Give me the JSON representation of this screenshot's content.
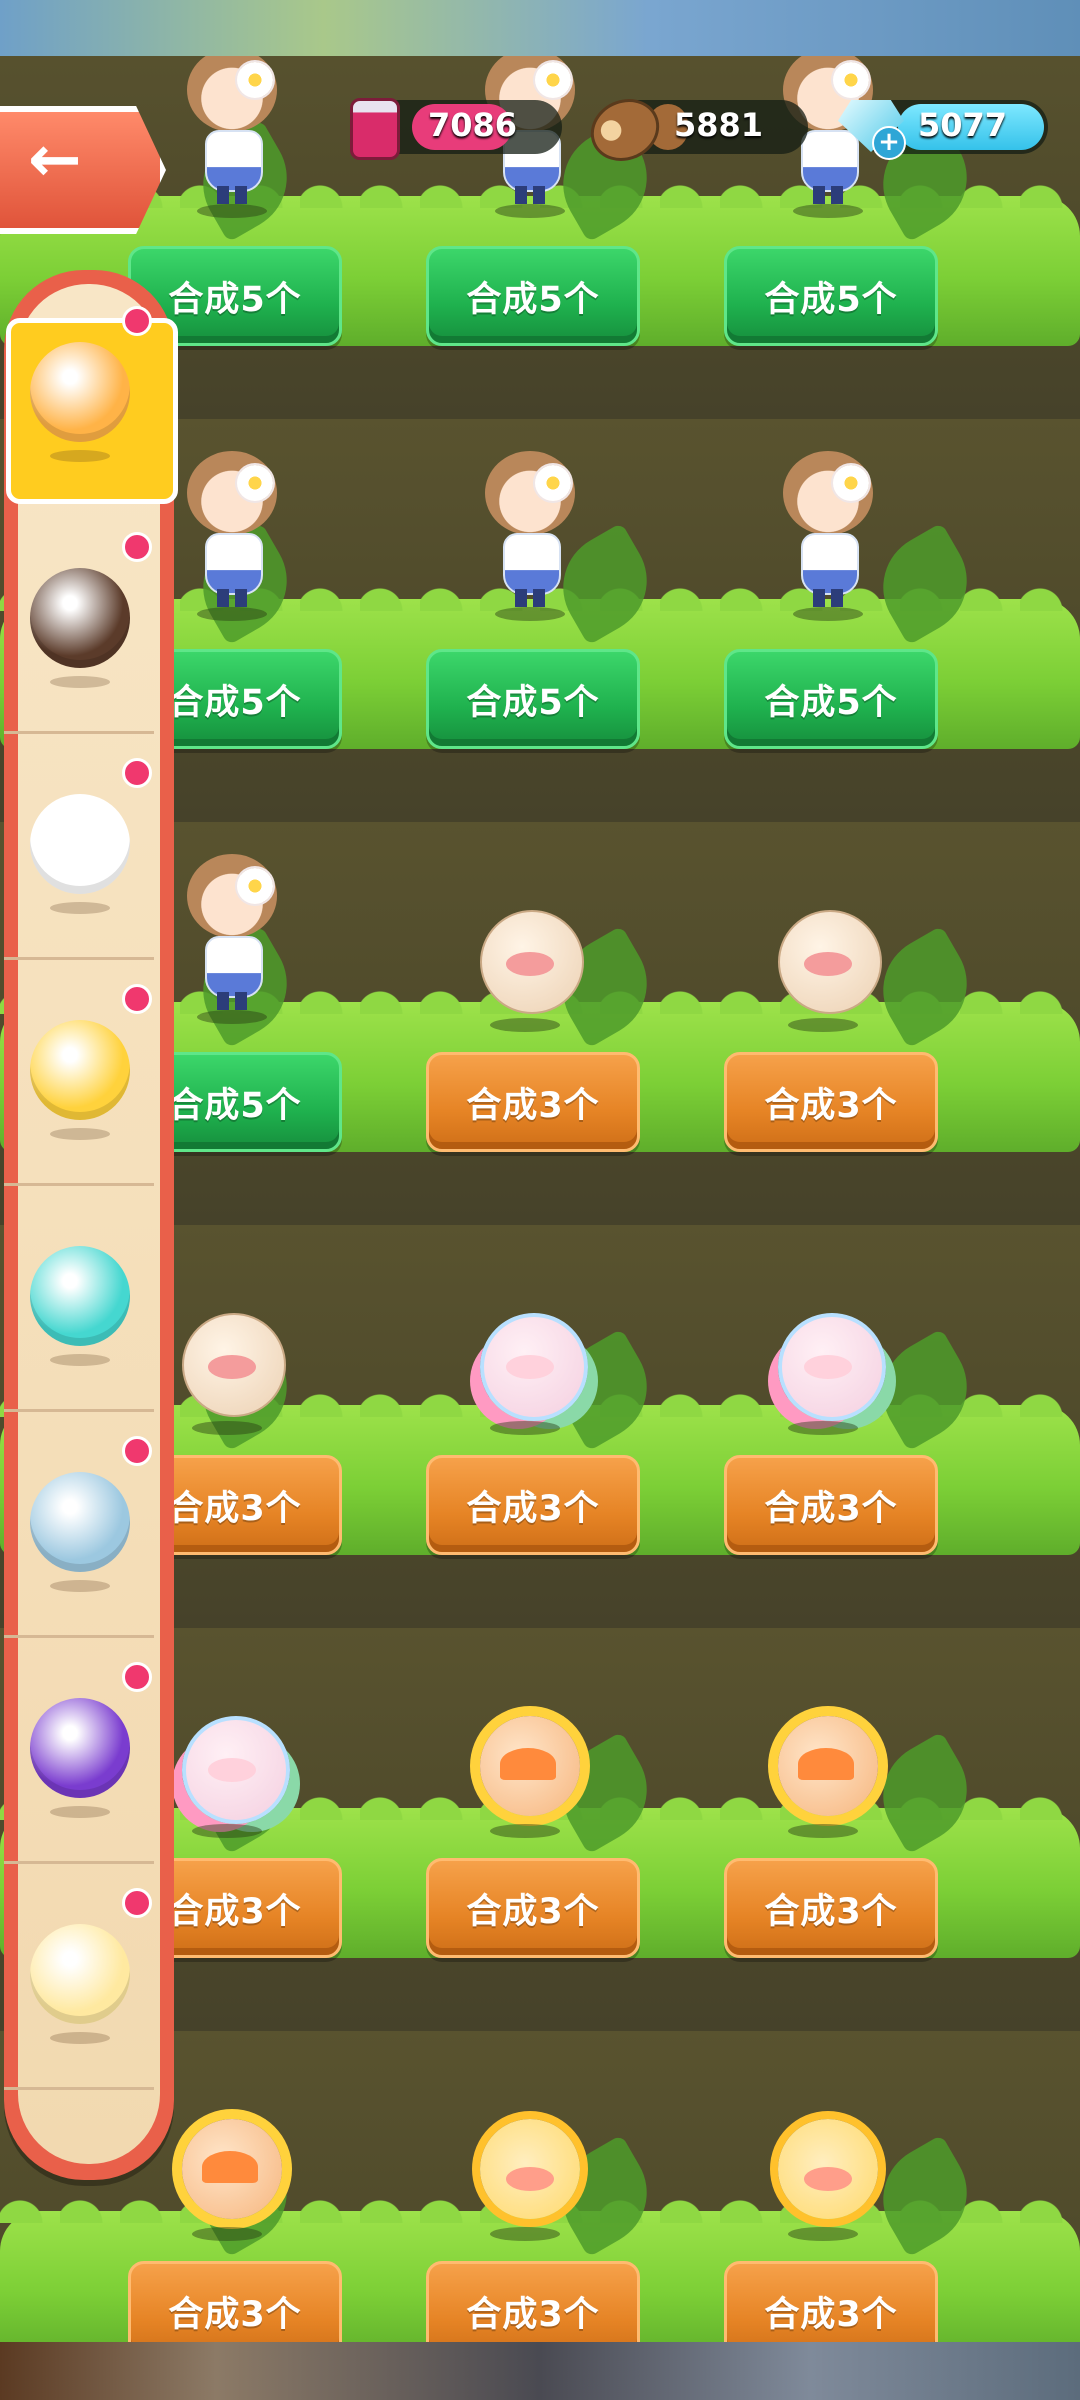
{
  "resources": {
    "ink": "7086",
    "wood": "5881",
    "gems": "5077",
    "add_gems_symbol": "+"
  },
  "back_button": {
    "symbol": "←"
  },
  "sidebar": {
    "items": [
      {
        "name": "orange-cat",
        "color": "#ffb347",
        "notification": true,
        "selected": true
      },
      {
        "name": "brown-bear",
        "color": "#5b3b2a",
        "notification": true,
        "selected": false
      },
      {
        "name": "white-rabbit",
        "color": "#ffffff",
        "notification": true,
        "selected": false
      },
      {
        "name": "blue-hooded-chick",
        "color": "#ffd23c",
        "notification": true,
        "selected": false
      },
      {
        "name": "teal-jellyfish",
        "color": "#45d7d0",
        "notification": false,
        "selected": false
      },
      {
        "name": "blue-cat",
        "color": "#9cc8e0",
        "notification": true,
        "selected": false
      },
      {
        "name": "purple-bird",
        "color": "#7a3ccf",
        "notification": true,
        "selected": false
      },
      {
        "name": "yellow-cow",
        "color": "#ffe9a0",
        "notification": true,
        "selected": false
      }
    ]
  },
  "grid": {
    "rows": [
      [
        {
          "character": "flower-girl",
          "button": "合成5个",
          "color": "green"
        },
        {
          "character": "flower-girl",
          "button": "合成5个",
          "color": "green"
        },
        {
          "character": "flower-girl",
          "button": "合成5个",
          "color": "green"
        }
      ],
      [
        {
          "character": "flower-girl",
          "button": "合成5个",
          "color": "green"
        },
        {
          "character": "flower-girl",
          "button": "合成5个",
          "color": "green"
        },
        {
          "character": "flower-girl",
          "button": "合成5个",
          "color": "green"
        }
      ],
      [
        {
          "character": "flower-girl",
          "button": "合成5个",
          "color": "green"
        },
        {
          "character": "pig-ball",
          "button": "合成3个",
          "color": "orange"
        },
        {
          "character": "pig-ball",
          "button": "合成3个",
          "color": "orange"
        }
      ],
      [
        {
          "character": "pig-ball",
          "button": "合成3个",
          "color": "orange"
        },
        {
          "character": "rainbow-unicorn",
          "button": "合成3个",
          "color": "orange"
        },
        {
          "character": "rainbow-unicorn",
          "button": "合成3个",
          "color": "orange"
        }
      ],
      [
        {
          "character": "rainbow-unicorn",
          "button": "合成3个",
          "color": "orange"
        },
        {
          "character": "sun-sprite",
          "button": "合成3个",
          "color": "orange"
        },
        {
          "character": "sun-sprite",
          "button": "合成3个",
          "color": "orange"
        }
      ],
      [
        {
          "character": "sun-sprite",
          "button": "合成3个",
          "color": "orange"
        },
        {
          "character": "lion-chick",
          "button": "合成3个",
          "color": "orange"
        },
        {
          "character": "lion-chick",
          "button": "合成3个",
          "color": "orange"
        }
      ]
    ]
  }
}
